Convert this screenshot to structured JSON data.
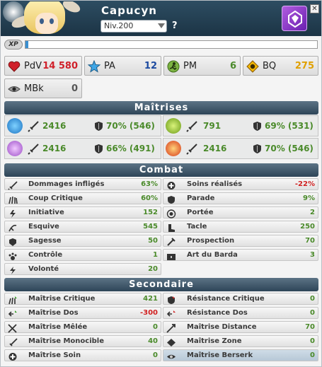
{
  "header": {
    "name": "Capucyn",
    "level_text": "Niv.200",
    "help_label": "?",
    "close_label": "✕"
  },
  "xp": {
    "label": "XP",
    "progress": 0.01
  },
  "resources": [
    {
      "label": "PdV",
      "value": "14 580",
      "color": "#d0202a",
      "icon": "heart-icon"
    },
    {
      "label": "PA",
      "value": "12",
      "color": "#1c4aa0",
      "icon": "star-icon"
    },
    {
      "label": "PM",
      "value": "6",
      "color": "#4a8a2a",
      "icon": "running-icon"
    },
    {
      "label": "BQ",
      "value": "275",
      "color": "#e0a000",
      "icon": "wakfu-orb-icon"
    },
    {
      "label": "MBk",
      "value": "0",
      "color": "#555555",
      "icon": "eye-icon"
    }
  ],
  "maitrises": {
    "title": "Maîtrises",
    "cells": [
      {
        "element": "water",
        "mastery": "2416",
        "resist": "70% (546)"
      },
      {
        "element": "earth",
        "mastery": "791",
        "resist": "69% (531)"
      },
      {
        "element": "air",
        "mastery": "2416",
        "resist": "66% (491)"
      },
      {
        "element": "fire",
        "mastery": "2416",
        "resist": "70% (546)"
      }
    ]
  },
  "combat": {
    "title": "Combat",
    "left": [
      {
        "name": "Dommages infligés",
        "value": "63%",
        "icon": "dagger-icon"
      },
      {
        "name": "Coup Critique",
        "value": "60%",
        "icon": "claw-icon"
      },
      {
        "name": "Initiative",
        "value": "152",
        "icon": "initiative-icon"
      },
      {
        "name": "Esquive",
        "value": "545",
        "icon": "dodge-icon"
      },
      {
        "name": "Sagesse",
        "value": "50",
        "icon": "wisdom-icon"
      },
      {
        "name": "Contrôle",
        "value": "1",
        "icon": "paw-icon"
      },
      {
        "name": "Volonté",
        "value": "20",
        "icon": "willpower-icon"
      }
    ],
    "right": [
      {
        "name": "Soins réalisés",
        "value": "-22%",
        "icon": "heal-icon",
        "negative": true
      },
      {
        "name": "Parade",
        "value": "9%",
        "icon": "block-icon"
      },
      {
        "name": "Portée",
        "value": "2",
        "icon": "range-icon"
      },
      {
        "name": "Tacle",
        "value": "250",
        "icon": "boot-icon"
      },
      {
        "name": "Prospection",
        "value": "70",
        "icon": "prospection-icon"
      },
      {
        "name": "Art du Barda",
        "value": "3",
        "icon": "chest-icon"
      }
    ]
  },
  "secondaire": {
    "title": "Secondaire",
    "left": [
      {
        "name": "Maîtrise Critique",
        "value": "421",
        "icon": "crit-mastery-icon"
      },
      {
        "name": "Maîtrise Dos",
        "value": "-300",
        "icon": "back-mastery-icon",
        "negative": true
      },
      {
        "name": "Maîtrise Mêlée",
        "value": "0",
        "icon": "melee-icon"
      },
      {
        "name": "Maîtrise Monocible",
        "value": "40",
        "icon": "single-target-icon"
      },
      {
        "name": "Maîtrise Soin",
        "value": "0",
        "icon": "heal-mastery-icon"
      }
    ],
    "right": [
      {
        "name": "Résistance Critique",
        "value": "0",
        "icon": "crit-resist-icon"
      },
      {
        "name": "Résistance Dos",
        "value": "0",
        "icon": "back-resist-icon"
      },
      {
        "name": "Maîtrise Distance",
        "value": "70",
        "icon": "distance-icon"
      },
      {
        "name": "Maîtrise Zone",
        "value": "0",
        "icon": "area-icon"
      },
      {
        "name": "Maîtrise Berserk",
        "value": "0",
        "icon": "berserk-icon",
        "highlight": true
      }
    ]
  }
}
